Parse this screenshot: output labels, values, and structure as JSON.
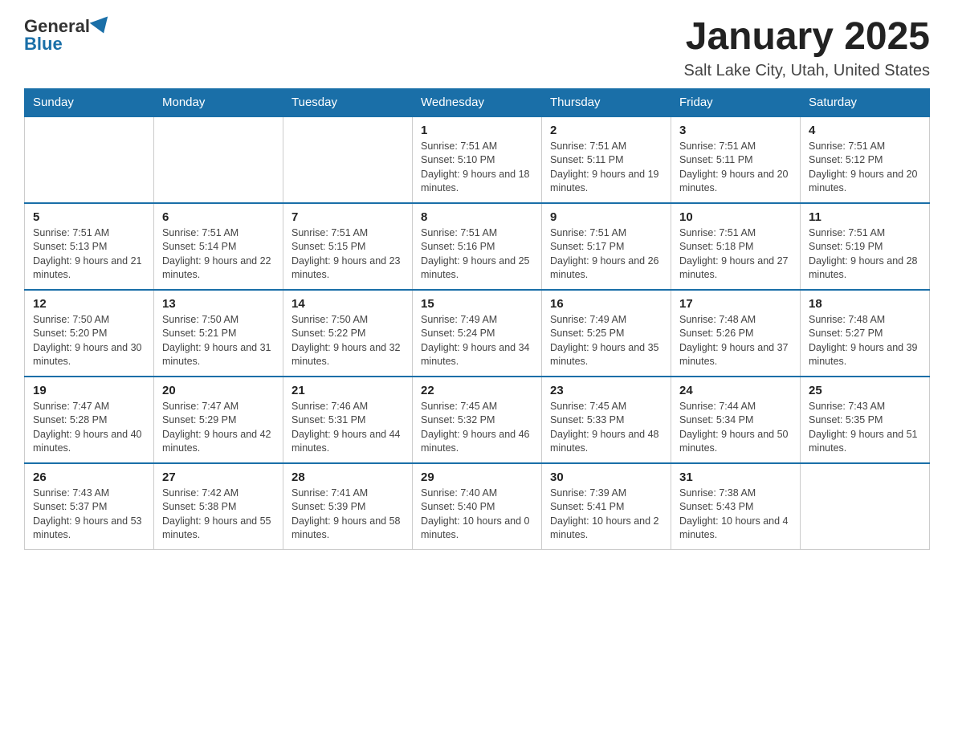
{
  "header": {
    "logo_general": "General",
    "logo_blue": "Blue",
    "month_title": "January 2025",
    "location": "Salt Lake City, Utah, United States"
  },
  "weekdays": [
    "Sunday",
    "Monday",
    "Tuesday",
    "Wednesday",
    "Thursday",
    "Friday",
    "Saturday"
  ],
  "weeks": [
    [
      {
        "day": "",
        "sunrise": "",
        "sunset": "",
        "daylight": ""
      },
      {
        "day": "",
        "sunrise": "",
        "sunset": "",
        "daylight": ""
      },
      {
        "day": "",
        "sunrise": "",
        "sunset": "",
        "daylight": ""
      },
      {
        "day": "1",
        "sunrise": "Sunrise: 7:51 AM",
        "sunset": "Sunset: 5:10 PM",
        "daylight": "Daylight: 9 hours and 18 minutes."
      },
      {
        "day": "2",
        "sunrise": "Sunrise: 7:51 AM",
        "sunset": "Sunset: 5:11 PM",
        "daylight": "Daylight: 9 hours and 19 minutes."
      },
      {
        "day": "3",
        "sunrise": "Sunrise: 7:51 AM",
        "sunset": "Sunset: 5:11 PM",
        "daylight": "Daylight: 9 hours and 20 minutes."
      },
      {
        "day": "4",
        "sunrise": "Sunrise: 7:51 AM",
        "sunset": "Sunset: 5:12 PM",
        "daylight": "Daylight: 9 hours and 20 minutes."
      }
    ],
    [
      {
        "day": "5",
        "sunrise": "Sunrise: 7:51 AM",
        "sunset": "Sunset: 5:13 PM",
        "daylight": "Daylight: 9 hours and 21 minutes."
      },
      {
        "day": "6",
        "sunrise": "Sunrise: 7:51 AM",
        "sunset": "Sunset: 5:14 PM",
        "daylight": "Daylight: 9 hours and 22 minutes."
      },
      {
        "day": "7",
        "sunrise": "Sunrise: 7:51 AM",
        "sunset": "Sunset: 5:15 PM",
        "daylight": "Daylight: 9 hours and 23 minutes."
      },
      {
        "day": "8",
        "sunrise": "Sunrise: 7:51 AM",
        "sunset": "Sunset: 5:16 PM",
        "daylight": "Daylight: 9 hours and 25 minutes."
      },
      {
        "day": "9",
        "sunrise": "Sunrise: 7:51 AM",
        "sunset": "Sunset: 5:17 PM",
        "daylight": "Daylight: 9 hours and 26 minutes."
      },
      {
        "day": "10",
        "sunrise": "Sunrise: 7:51 AM",
        "sunset": "Sunset: 5:18 PM",
        "daylight": "Daylight: 9 hours and 27 minutes."
      },
      {
        "day": "11",
        "sunrise": "Sunrise: 7:51 AM",
        "sunset": "Sunset: 5:19 PM",
        "daylight": "Daylight: 9 hours and 28 minutes."
      }
    ],
    [
      {
        "day": "12",
        "sunrise": "Sunrise: 7:50 AM",
        "sunset": "Sunset: 5:20 PM",
        "daylight": "Daylight: 9 hours and 30 minutes."
      },
      {
        "day": "13",
        "sunrise": "Sunrise: 7:50 AM",
        "sunset": "Sunset: 5:21 PM",
        "daylight": "Daylight: 9 hours and 31 minutes."
      },
      {
        "day": "14",
        "sunrise": "Sunrise: 7:50 AM",
        "sunset": "Sunset: 5:22 PM",
        "daylight": "Daylight: 9 hours and 32 minutes."
      },
      {
        "day": "15",
        "sunrise": "Sunrise: 7:49 AM",
        "sunset": "Sunset: 5:24 PM",
        "daylight": "Daylight: 9 hours and 34 minutes."
      },
      {
        "day": "16",
        "sunrise": "Sunrise: 7:49 AM",
        "sunset": "Sunset: 5:25 PM",
        "daylight": "Daylight: 9 hours and 35 minutes."
      },
      {
        "day": "17",
        "sunrise": "Sunrise: 7:48 AM",
        "sunset": "Sunset: 5:26 PM",
        "daylight": "Daylight: 9 hours and 37 minutes."
      },
      {
        "day": "18",
        "sunrise": "Sunrise: 7:48 AM",
        "sunset": "Sunset: 5:27 PM",
        "daylight": "Daylight: 9 hours and 39 minutes."
      }
    ],
    [
      {
        "day": "19",
        "sunrise": "Sunrise: 7:47 AM",
        "sunset": "Sunset: 5:28 PM",
        "daylight": "Daylight: 9 hours and 40 minutes."
      },
      {
        "day": "20",
        "sunrise": "Sunrise: 7:47 AM",
        "sunset": "Sunset: 5:29 PM",
        "daylight": "Daylight: 9 hours and 42 minutes."
      },
      {
        "day": "21",
        "sunrise": "Sunrise: 7:46 AM",
        "sunset": "Sunset: 5:31 PM",
        "daylight": "Daylight: 9 hours and 44 minutes."
      },
      {
        "day": "22",
        "sunrise": "Sunrise: 7:45 AM",
        "sunset": "Sunset: 5:32 PM",
        "daylight": "Daylight: 9 hours and 46 minutes."
      },
      {
        "day": "23",
        "sunrise": "Sunrise: 7:45 AM",
        "sunset": "Sunset: 5:33 PM",
        "daylight": "Daylight: 9 hours and 48 minutes."
      },
      {
        "day": "24",
        "sunrise": "Sunrise: 7:44 AM",
        "sunset": "Sunset: 5:34 PM",
        "daylight": "Daylight: 9 hours and 50 minutes."
      },
      {
        "day": "25",
        "sunrise": "Sunrise: 7:43 AM",
        "sunset": "Sunset: 5:35 PM",
        "daylight": "Daylight: 9 hours and 51 minutes."
      }
    ],
    [
      {
        "day": "26",
        "sunrise": "Sunrise: 7:43 AM",
        "sunset": "Sunset: 5:37 PM",
        "daylight": "Daylight: 9 hours and 53 minutes."
      },
      {
        "day": "27",
        "sunrise": "Sunrise: 7:42 AM",
        "sunset": "Sunset: 5:38 PM",
        "daylight": "Daylight: 9 hours and 55 minutes."
      },
      {
        "day": "28",
        "sunrise": "Sunrise: 7:41 AM",
        "sunset": "Sunset: 5:39 PM",
        "daylight": "Daylight: 9 hours and 58 minutes."
      },
      {
        "day": "29",
        "sunrise": "Sunrise: 7:40 AM",
        "sunset": "Sunset: 5:40 PM",
        "daylight": "Daylight: 10 hours and 0 minutes."
      },
      {
        "day": "30",
        "sunrise": "Sunrise: 7:39 AM",
        "sunset": "Sunset: 5:41 PM",
        "daylight": "Daylight: 10 hours and 2 minutes."
      },
      {
        "day": "31",
        "sunrise": "Sunrise: 7:38 AM",
        "sunset": "Sunset: 5:43 PM",
        "daylight": "Daylight: 10 hours and 4 minutes."
      },
      {
        "day": "",
        "sunrise": "",
        "sunset": "",
        "daylight": ""
      }
    ]
  ]
}
